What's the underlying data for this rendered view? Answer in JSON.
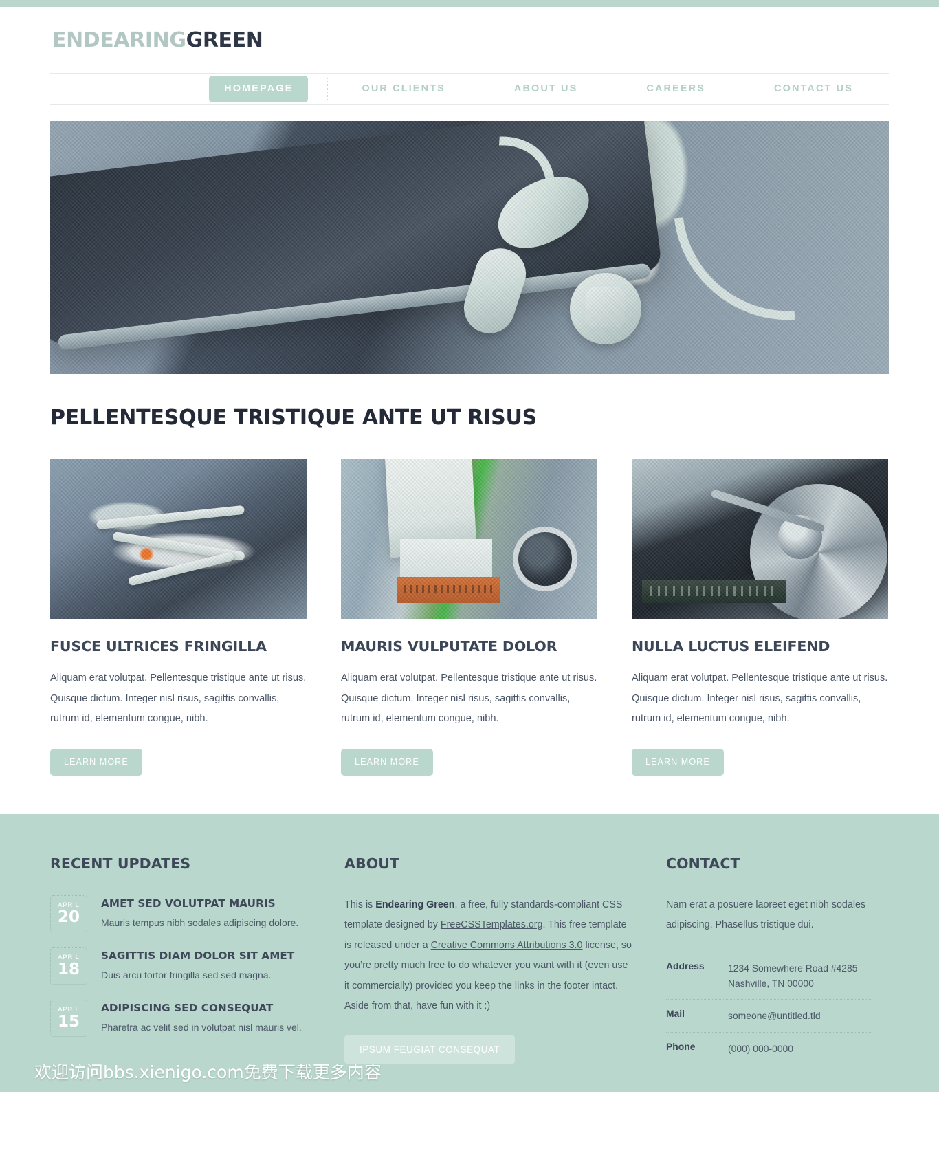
{
  "theme": {
    "accent": "#b9d7cd",
    "accent_light": "#cde3db",
    "dark_text": "#3e4859",
    "body_text": "#4c5866",
    "logo_light": "#b3c7c2",
    "logo_dark": "#2e3645"
  },
  "header": {
    "logo_part1": "ENDEARING",
    "logo_part2": "GREEN"
  },
  "nav": {
    "items": [
      {
        "label": "HOMEPAGE",
        "active": true
      },
      {
        "label": "OUR CLIENTS",
        "active": false
      },
      {
        "label": "ABOUT US",
        "active": false
      },
      {
        "label": "CAREERS",
        "active": false
      },
      {
        "label": "CONTACT US",
        "active": false
      }
    ]
  },
  "hero": {
    "alt": "smartphone-and-earbuds-photo"
  },
  "main": {
    "section_title": "PELLENTESQUE TRISTIQUE ANTE UT RISUS",
    "cards": [
      {
        "title": "FUSCE ULTRICES FRINGILLA",
        "text": "Aliquam erat volutpat. Pellentesque tristique ante ut risus. Quisque dictum. Integer nisl risus, sagittis convallis, rutrum id, elementum congue, nibh.",
        "button": "LEARN MORE",
        "image_alt": "frayed-wires-photo"
      },
      {
        "title": "MAURIS VULPUTATE DOLOR",
        "text": "Aliquam erat volutpat. Pellentesque tristique ante ut risus. Quisque dictum. Integer nisl risus, sagittis convallis, rutrum id, elementum congue, nibh.",
        "button": "LEARN MORE",
        "image_alt": "circuit-board-connector-photo"
      },
      {
        "title": "NULLA LUCTUS ELEIFEND",
        "text": "Aliquam erat volutpat. Pellentesque tristique ante ut risus. Quisque dictum. Integer nisl risus, sagittis convallis, rutrum id, elementum congue, nibh.",
        "button": "LEARN MORE",
        "image_alt": "open-hard-disk-drive-photo"
      }
    ]
  },
  "footer": {
    "updates": {
      "title": "RECENT UPDATES",
      "items": [
        {
          "month": "APRIL",
          "day": "20",
          "title": "AMET SED VOLUTPAT MAURIS",
          "desc": "Mauris tempus nibh sodales adipiscing dolore."
        },
        {
          "month": "APRIL",
          "day": "18",
          "title": "SAGITTIS DIAM DOLOR SIT AMET",
          "desc": "Duis arcu tortor fringilla sed sed magna."
        },
        {
          "month": "APRIL",
          "day": "15",
          "title": "ADIPISCING SED CONSEQUAT",
          "desc": "Pharetra ac velit sed in volutpat nisl mauris vel."
        }
      ]
    },
    "about": {
      "title": "ABOUT",
      "p_1": "This is ",
      "brand": "Endearing Green",
      "p_2": ", a free, fully standards-compliant CSS template designed by ",
      "link_1": "FreeCSSTemplates.org",
      "p_3": ". This free template is released under a ",
      "link_2": "Creative Commons Attributions 3.0",
      "p_4": " license, so you’re pretty much free to do whatever you want with it (even use it commercially) provided you keep the links in the footer intact. Aside from that, have fun with it :)",
      "button": "IPSUM FEUGIAT CONSEQUAT"
    },
    "contact": {
      "title": "CONTACT",
      "intro": "Nam erat a posuere laoreet eget nibh sodales adipiscing. Phasellus tristique dui.",
      "rows": [
        {
          "label": "Address",
          "value": "1234 Somewhere Road #4285\nNashville, TN 00000",
          "is_link": false
        },
        {
          "label": "Mail",
          "value": "someone@untitled.tld",
          "is_link": true
        },
        {
          "label": "Phone",
          "value": "(000) 000-0000",
          "is_link": false
        }
      ]
    }
  },
  "watermark": {
    "text": "欢迎访问bbs.xienigo.com免费下载更多内容"
  }
}
